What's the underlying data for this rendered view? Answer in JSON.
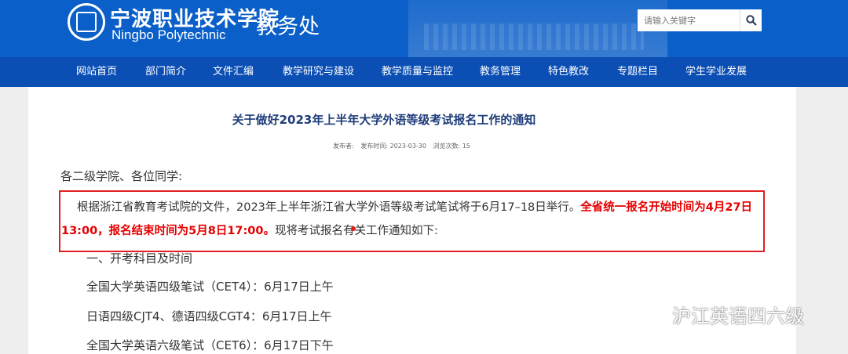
{
  "header": {
    "school_cn": "宁波职业技术学院",
    "school_en": "Ningbo Polytechnic",
    "dept": "教务处",
    "search_placeholder": "请输入关键字",
    "search_icon": "search-icon"
  },
  "nav": [
    {
      "label": "网站首页"
    },
    {
      "label": "部门简介"
    },
    {
      "label": "文件汇编"
    },
    {
      "label": "教学研究与建设"
    },
    {
      "label": "教学质量与监控"
    },
    {
      "label": "教务管理"
    },
    {
      "label": "特色教改"
    },
    {
      "label": "专题栏目"
    },
    {
      "label": "学生学业发展"
    }
  ],
  "article": {
    "title": "关于做好2023年上半年大学外语等级考试报名工作的通知",
    "meta": {
      "author": "发布者:",
      "date": "发布时间: 2023-03-30",
      "views": "浏览次数: 15"
    },
    "greeting": "各二级学院、各位同学:",
    "para1_a": "根据浙江省教育考试院的文件，2023年上半年浙江省大学外语等级考试笔试将于6月17–18日举行。",
    "para1_red": "全省统一报名开始时间为4月27日13:00，报名结束时间为5月8日17:00。",
    "para1_b": "现将考试报名有关工作通知如下:",
    "section1": "一、开考科目及时间",
    "items": [
      "全国大学英语四级笔试（CET4）：6月17日上午",
      "日语四级CJT4、德语四级CGT4：6月17日上午",
      "全国大学英语六级笔试（CET6）：6月17日下午"
    ]
  },
  "watermark": {
    "text": "沪江英语四六级",
    "icon": "wechat-icon"
  },
  "colors": {
    "header_bg": "#0b5fc8",
    "nav_bg": "#0b4fb5",
    "title": "#1f3d7a",
    "highlight": "#e60000"
  }
}
